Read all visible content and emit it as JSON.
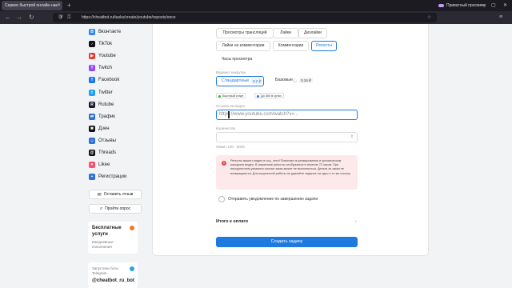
{
  "browser": {
    "tab_title": "Сервис быстрой онлайн-нак",
    "url": "https://cheatbot.ru/tasks/create/youtube/reposts/once",
    "private_label": "Приватный просмотр",
    "tab_close": "✕",
    "new_tab": "+",
    "back": "←",
    "forward": "→",
    "reload": "↻",
    "shield_icon": "🛡",
    "star_icon": "☆",
    "menu_icon": "≡",
    "win_min": "—",
    "win_max": "▢",
    "win_close": "✕"
  },
  "sidebar": {
    "items": [
      {
        "label": "Вконтакте",
        "color": "#2787f5",
        "glyph": "В"
      },
      {
        "label": "TikTok",
        "color": "#111111",
        "glyph": "♪"
      },
      {
        "label": "Youtube",
        "color": "#e53935",
        "glyph": "▶"
      },
      {
        "label": "Twitch",
        "color": "#9146ff",
        "glyph": "T"
      },
      {
        "label": "Facebook",
        "color": "#1877f2",
        "glyph": "f"
      },
      {
        "label": "Twitter",
        "color": "#1da1f2",
        "glyph": "t"
      },
      {
        "label": "Rutube",
        "color": "#1a1a2e",
        "glyph": "R"
      },
      {
        "label": "Трафик",
        "color": "#2a70d6",
        "glyph": "⇄"
      },
      {
        "label": "Дзен",
        "color": "#111111",
        "glyph": "✱"
      },
      {
        "label": "Отзывы",
        "color": "#2a70d6",
        "glyph": "☺"
      },
      {
        "label": "Threads",
        "color": "#111111",
        "glyph": "@"
      },
      {
        "label": "Likee",
        "color": "#ff4d6d",
        "glyph": "♥"
      },
      {
        "label": "Регистрации",
        "color": "#2a70d6",
        "glyph": "+"
      }
    ],
    "review_button": "Оставить отзыв",
    "review_icon": "✉",
    "survey_button": "Пройти опрос",
    "survey_icon": "⌕",
    "free_services": {
      "title": "Бесплатные услуги",
      "subtitle": "Ежедневные пополнения"
    },
    "telegram": {
      "subtitle": "Запустили бота Telegram",
      "handle": "@cheatbot_ru_bot"
    }
  },
  "main": {
    "tabs": [
      "Просмотры трансляций",
      "Лайки",
      "Дизлайки",
      "Лайки на комментарии",
      "Комментарии",
      "Репосты",
      "Часы просмотра"
    ],
    "active_tab": "Репосты",
    "boost_label": "Вариант накрутки",
    "options": [
      {
        "label": "Стандартные",
        "price": "0.2 ₽"
      },
      {
        "label": "Базовые",
        "price": "0.16 ₽"
      }
    ],
    "tags": [
      "Быстрый старт",
      "До 500 в сутки"
    ],
    "link_label": "Ссылка на видео",
    "link_placeholder": "https://www.youtube.com/watch?v=...",
    "quantity_label": "Количество",
    "quantity_hint": "Лимит 100 - 8000",
    "quantity_stepper": "⇕",
    "alert_text": "Репосты вашего видео в соц. сети! Помогают в ранжировании и органическом раскрутке видео. В аналитике репосты отобразятся в течение 72 часов. При некорректном указании ссылки заказ может не выполниться. Деньги за заказ не возвращаются. Для корректной работы не удаляйте задание на одно и то же ссылку.",
    "alert_icon": "!",
    "notify_label": "Отправить уведомление по завершению задачи",
    "total_label": "Итого к оплате",
    "total_chevron": "⌄",
    "submit_label": "Создать задачу"
  },
  "colors": {
    "accent": "#1f7ae0",
    "alert_bg": "#fde9e9"
  }
}
